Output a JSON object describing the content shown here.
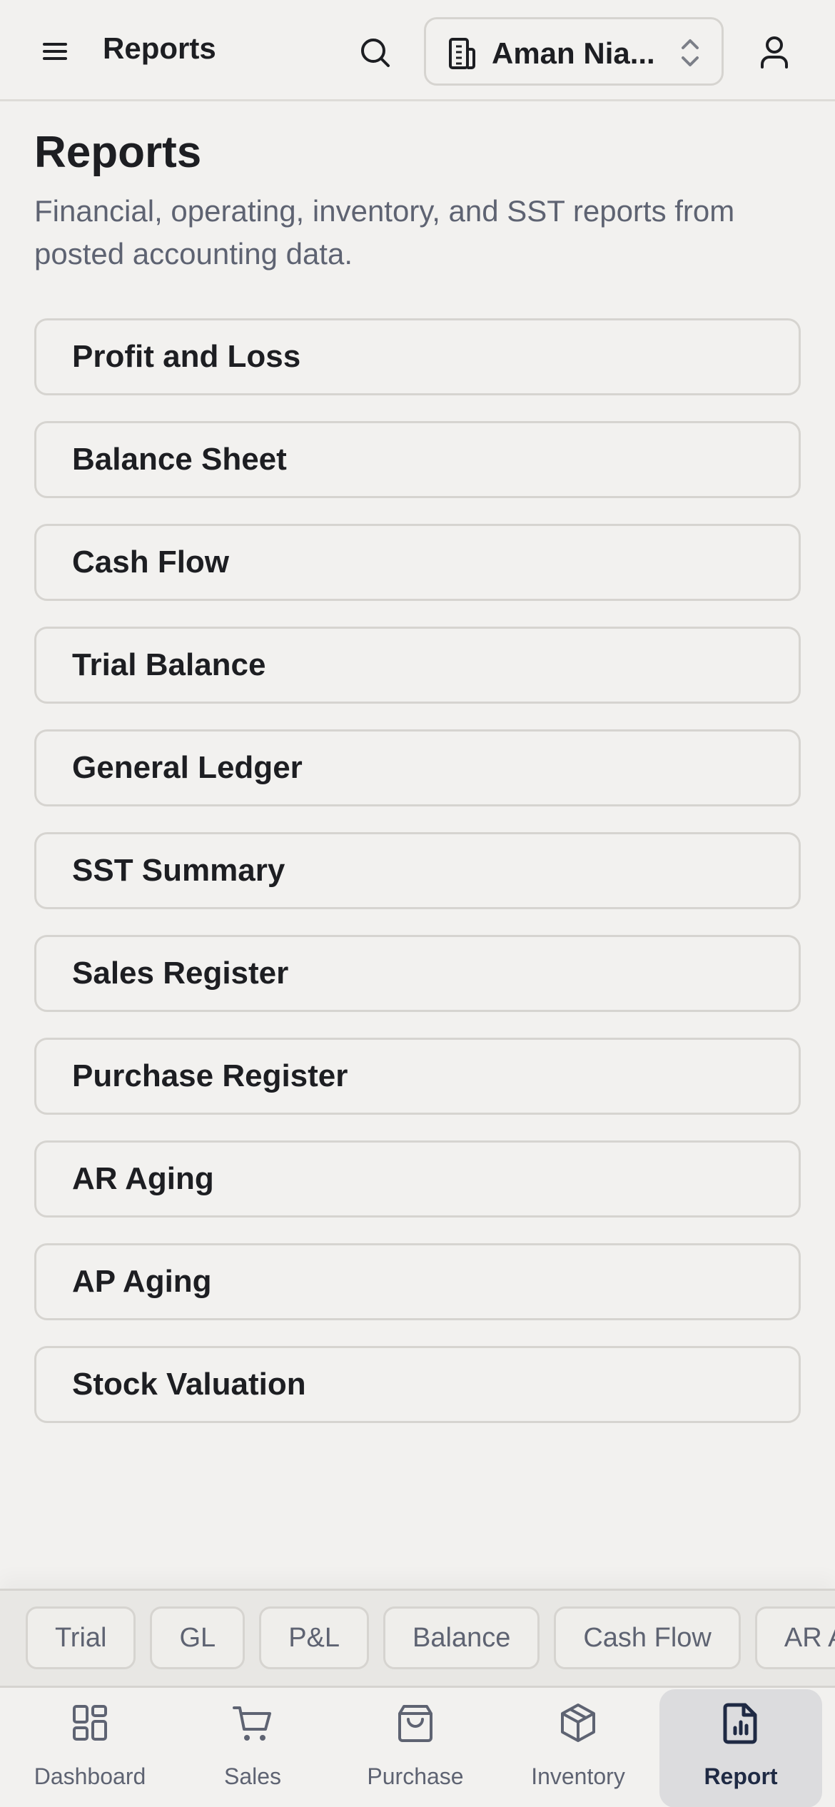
{
  "header": {
    "title": "Reports",
    "org_name": "Aman Nia...",
    "icons": [
      "menu-icon",
      "search-icon",
      "building-icon",
      "chevron-updown-icon",
      "user-icon"
    ]
  },
  "page": {
    "title": "Reports",
    "description": "Financial, operating, inventory, and SST reports from posted accounting data."
  },
  "reports": [
    {
      "label": "Profit and Loss"
    },
    {
      "label": "Balance Sheet"
    },
    {
      "label": "Cash Flow"
    },
    {
      "label": "Trial Balance"
    },
    {
      "label": "General Ledger"
    },
    {
      "label": "SST Summary"
    },
    {
      "label": "Sales Register"
    },
    {
      "label": "Purchase Register"
    },
    {
      "label": "AR Aging"
    },
    {
      "label": "AP Aging"
    },
    {
      "label": "Stock Valuation"
    }
  ],
  "quick_chips": [
    {
      "label": "Trial"
    },
    {
      "label": "GL"
    },
    {
      "label": "P&L"
    },
    {
      "label": "Balance"
    },
    {
      "label": "Cash Flow"
    },
    {
      "label": "AR Aging"
    }
  ],
  "bottom_nav": [
    {
      "label": "Dashboard",
      "icon": "dashboard-icon"
    },
    {
      "label": "Sales",
      "icon": "cart-icon"
    },
    {
      "label": "Purchase",
      "icon": "shopping-bag-icon"
    },
    {
      "label": "Inventory",
      "icon": "box-icon"
    },
    {
      "label": "Report",
      "icon": "report-icon",
      "active": true
    }
  ],
  "colors": {
    "background": "#f2f1ef",
    "text_primary": "#1d1e22",
    "text_muted": "#5e6372",
    "border": "#d6d4d0",
    "active_nav_bg": "#dcdcde",
    "active_nav_text": "#1f2a44"
  }
}
